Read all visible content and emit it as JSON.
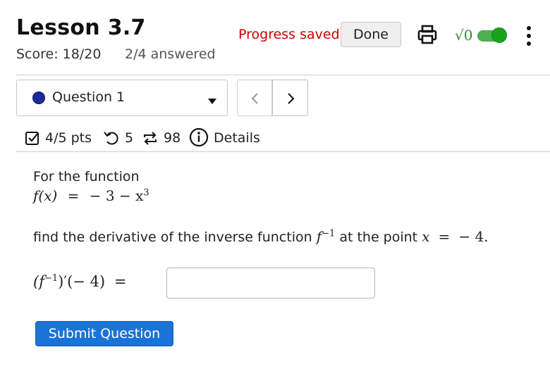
{
  "header": {
    "title": "Lesson 3.7",
    "score": "Score: 18/20",
    "answered": "2/4 answered",
    "progress_status": "Progress saved",
    "done_label": "Done",
    "math_toggle_label": "√0",
    "math_toggle_on": true,
    "icons": [
      "printer-icon",
      "kebab-menu-icon"
    ]
  },
  "question_nav": {
    "selected_question": "Question 1",
    "status_color": "#1a2a9e",
    "prev_icon": "chevron-left-icon",
    "next_icon": "chevron-right-icon"
  },
  "info_row": {
    "points": "4/5 pts",
    "attempts": "5",
    "retries": "98",
    "details_label": "Details",
    "icons": [
      "checkbox-icon",
      "undo-icon",
      "repeat-icon",
      "info-icon"
    ]
  },
  "question": {
    "intro": "For the function",
    "function_lhs": "f(x)",
    "function_rhs": "− 3 − x",
    "function_exponent": "3",
    "prompt_prefix": "find the derivative of the inverse function",
    "inverse_symbol": "f",
    "inverse_exponent": "−1",
    "prompt_mid": "at the point",
    "point_var": "x",
    "point_value": "− 4.",
    "answer_lhs_open": "(f",
    "answer_lhs_exp": "−1",
    "answer_lhs_close": ")′(− 4)",
    "equals": "=",
    "answer_value": ""
  },
  "actions": {
    "submit_label": "Submit Question",
    "accent_color": "#1a73d6",
    "progress_color": "#cc0000",
    "toggle_color": "#1aa31a"
  }
}
